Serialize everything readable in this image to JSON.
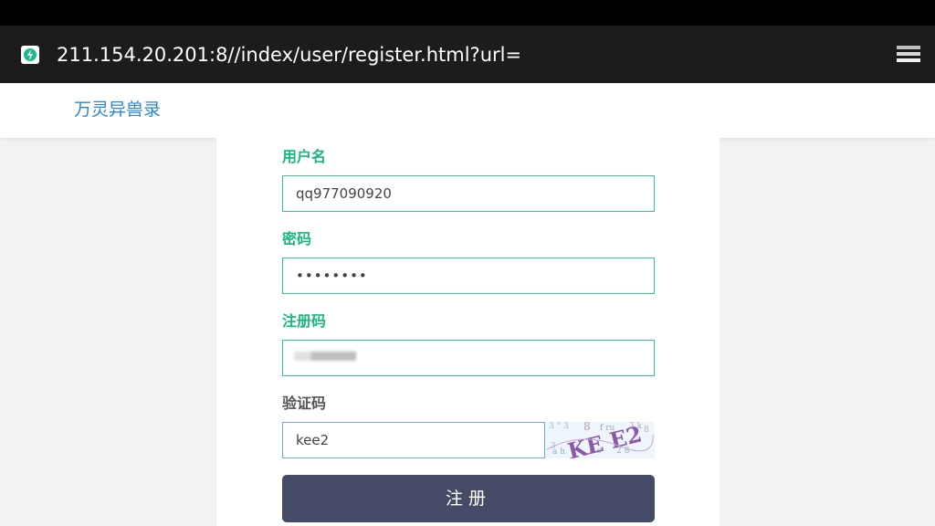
{
  "browser": {
    "url": "211.154.20.201:8//index/user/register.html?url=",
    "site_icon": "bolt-shield-icon",
    "menu_icon": "tabs-stack-icon"
  },
  "header": {
    "app_title": "万灵异兽录"
  },
  "form": {
    "username_label": "用户名",
    "username_value": "qq977090920",
    "password_label": "密码",
    "password_value": "••••••••",
    "regcode_label": "注册码",
    "regcode_value": "",
    "captcha_label": "验证码",
    "captcha_value": "kee2",
    "captcha_image_text": "KE E2",
    "submit_label": "注册"
  },
  "colors": {
    "accent_green": "#19b77f",
    "input_border": "#34c796",
    "focus_border": "#6ea8e6",
    "button_bg": "#454a66",
    "title_blue": "#2a86d4"
  }
}
